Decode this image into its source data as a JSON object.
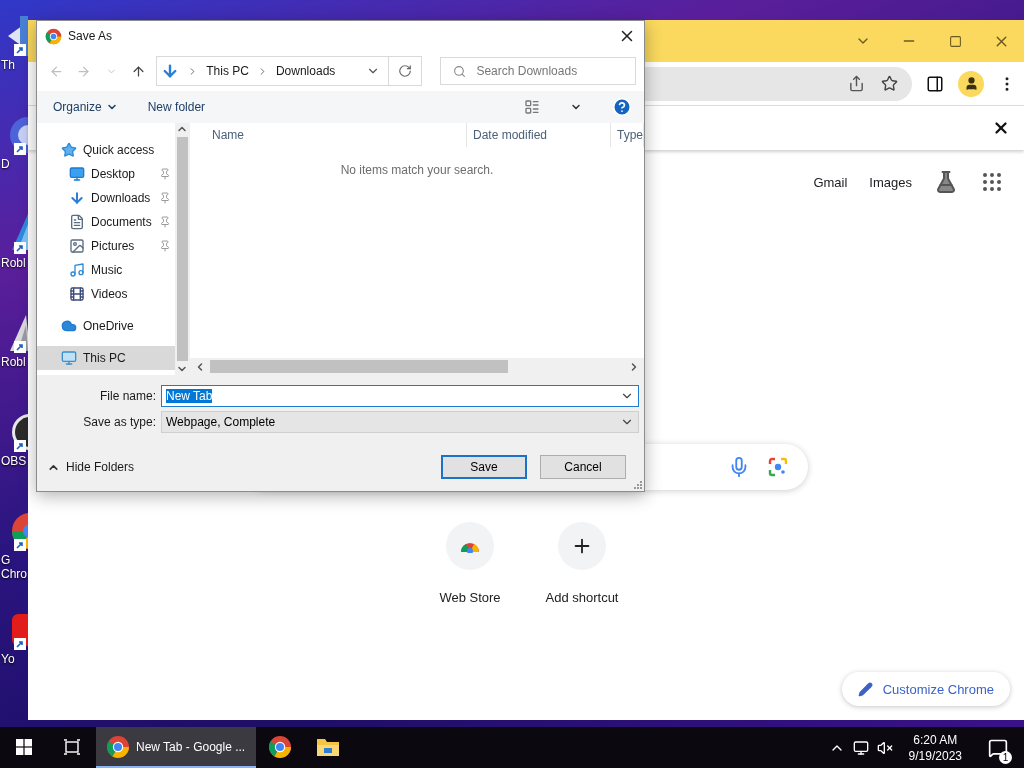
{
  "desktop_icons": [
    {
      "label": "Th",
      "kind": "arrow"
    },
    {
      "label": "D",
      "kind": "disc"
    },
    {
      "label": "Robl",
      "kind": "studio"
    },
    {
      "label": "Robl",
      "kind": "roblox"
    },
    {
      "label": "OBS",
      "kind": "obs"
    },
    {
      "label": "G Chro",
      "kind": "chrome"
    },
    {
      "label": "Yo",
      "kind": "youtube"
    }
  ],
  "browser": {
    "links": [
      "Gmail",
      "Images"
    ],
    "shortcuts": [
      {
        "label": "Web Store",
        "kind": "webstore"
      },
      {
        "label": "Add shortcut",
        "kind": "add"
      }
    ],
    "customize_button": "Customize Chrome"
  },
  "dialog": {
    "title": "Save As",
    "breadcrumb": [
      "This PC",
      "Downloads"
    ],
    "search_placeholder": "Search Downloads",
    "organize": "Organize",
    "new_folder": "New folder",
    "columns": [
      "Name",
      "Date modified",
      "Type"
    ],
    "empty_message": "No items match your search.",
    "nav": [
      {
        "label": "Quick access",
        "kind": "star",
        "selected": false,
        "children": [
          {
            "label": "Desktop",
            "kind": "desktop",
            "pinned": true,
            "selected": false
          },
          {
            "label": "Downloads",
            "kind": "download",
            "pinned": true,
            "selected": false
          },
          {
            "label": "Documents",
            "kind": "document",
            "pinned": true,
            "selected": false
          },
          {
            "label": "Pictures",
            "kind": "picture",
            "pinned": true,
            "selected": false
          },
          {
            "label": "Music",
            "kind": "music",
            "pinned": false,
            "selected": false
          },
          {
            "label": "Videos",
            "kind": "video",
            "pinned": false,
            "selected": false
          }
        ]
      },
      {
        "label": "OneDrive",
        "kind": "cloud",
        "selected": false
      },
      {
        "label": "This PC",
        "kind": "pc",
        "selected": true
      }
    ],
    "file_name": {
      "label": "File name:",
      "value": "New Tab",
      "highlighted": true
    },
    "save_as_type": {
      "label": "Save as type:",
      "value": "Webpage, Complete"
    },
    "buttons": [
      {
        "label": "Save",
        "default": true
      },
      {
        "label": "Cancel",
        "default": false
      }
    ],
    "hide_folders": "Hide Folders"
  },
  "taskbar": {
    "tasks": [
      {
        "label": "New Tab - Google ...",
        "kind": "chrome",
        "active": true
      },
      {
        "kind": "chrome",
        "active": false
      },
      {
        "kind": "explorer",
        "active": false
      }
    ],
    "time": "6:20 AM",
    "date": "9/19/2023",
    "notification_count": "1"
  }
}
